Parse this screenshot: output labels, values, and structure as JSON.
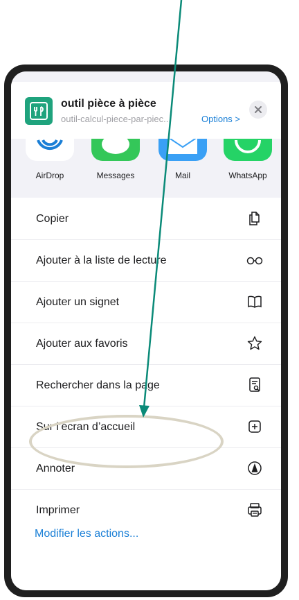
{
  "share_sheet": {
    "title": "outil pièce à pièce",
    "subtitle": "outil-calcul-piece-par-piec...",
    "options_label": "Options >",
    "close_icon": "close-icon"
  },
  "apps": [
    {
      "label": "AirDrop",
      "icon": "airdrop-icon",
      "color": "#ffffff"
    },
    {
      "label": "Messages",
      "icon": "messages-icon",
      "color": "#34c759"
    },
    {
      "label": "Mail",
      "icon": "mail-icon",
      "color": "#3aa0f5"
    },
    {
      "label": "WhatsApp",
      "icon": "whatsapp-icon",
      "color": "#25d366"
    }
  ],
  "actions": [
    {
      "label": "Copier",
      "icon": "copy-icon"
    },
    {
      "label": "Ajouter à la liste de lecture",
      "icon": "glasses-icon"
    },
    {
      "label": "Ajouter un signet",
      "icon": "book-icon"
    },
    {
      "label": "Ajouter aux favoris",
      "icon": "star-icon"
    },
    {
      "label": "Rechercher dans la page",
      "icon": "search-page-icon"
    },
    {
      "label": "Sur l’écran d’accueil",
      "icon": "add-square-icon"
    },
    {
      "label": "Annoter",
      "icon": "markup-icon"
    },
    {
      "label": "Imprimer",
      "icon": "print-icon"
    }
  ],
  "footer": {
    "modify_label": "Modifier les actions..."
  },
  "colors": {
    "accent_blue": "#1a7fd6",
    "brand_green": "#1fa37d",
    "annotation_arrow": "#0a8a78",
    "annotation_ellipse": "#d9d4c4"
  }
}
